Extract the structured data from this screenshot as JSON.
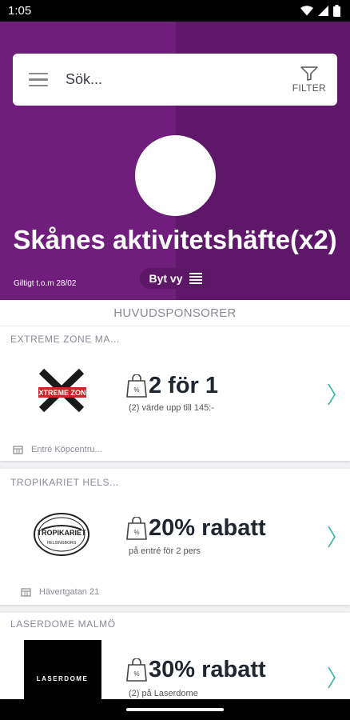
{
  "status_bar": {
    "time": "1:05"
  },
  "search": {
    "placeholder": "Sök...",
    "filter_label": "FILTER"
  },
  "booklet": {
    "title": "Skånes aktivitetshäfte(x2)",
    "valid_until": "Giltigt t.o.m 28/02",
    "switch_view_label": "Byt vy"
  },
  "section_title": "HUVUDSPONSORER",
  "offers": [
    {
      "name": "EXTREME ZONE MA...",
      "offer": "2 för 1",
      "detail": "(2) värde upp till 145:-",
      "address": "Entré Köpcentru..."
    },
    {
      "name": "TROPIKARIET HELS...",
      "offer": "20% rabatt",
      "detail": "på entré för 2 pers",
      "address": "Hävertgatan 21"
    },
    {
      "name": "LASERDOME MALMÖ",
      "offer": "30% rabatt",
      "detail": "(2) på Laserdome",
      "logo_text": "LASERDOME"
    }
  ],
  "logos": {
    "extreme_zone": "EXTREME ZONE",
    "tropikariet": "TROPIKARIET",
    "tropikariet_sub": "HELSINGBORG"
  },
  "colors": {
    "header": "#701e7c",
    "header_dark": "#5f1869",
    "accent": "#2bb39a",
    "text": "#1f2630"
  }
}
